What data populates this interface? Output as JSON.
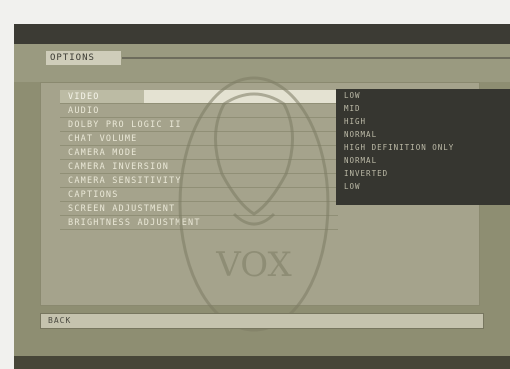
{
  "header": {
    "title": "OPTIONS"
  },
  "menu": {
    "items": [
      {
        "label": "VIDEO"
      },
      {
        "label": "AUDIO"
      },
      {
        "label": "DOLBY PRO LOGIC II"
      },
      {
        "label": "CHAT VOLUME"
      },
      {
        "label": "CAMERA MODE"
      },
      {
        "label": "CAMERA INVERSION"
      },
      {
        "label": "CAMERA SENSITIVITY"
      },
      {
        "label": "CAPTIONS"
      },
      {
        "label": "SCREEN ADJUSTMENT"
      },
      {
        "label": "BRIGHTNESS ADJUSTMENT"
      }
    ]
  },
  "submenu": {
    "items": [
      {
        "label": "LOW"
      },
      {
        "label": "MID"
      },
      {
        "label": "HIGH"
      },
      {
        "label": "NORMAL"
      },
      {
        "label": "HIGH DEFINITION ONLY"
      },
      {
        "label": "NORMAL"
      },
      {
        "label": "INVERTED"
      },
      {
        "label": "LOW"
      }
    ]
  },
  "status": {
    "text": "BACK"
  },
  "watermark": {
    "text": "VOX"
  }
}
